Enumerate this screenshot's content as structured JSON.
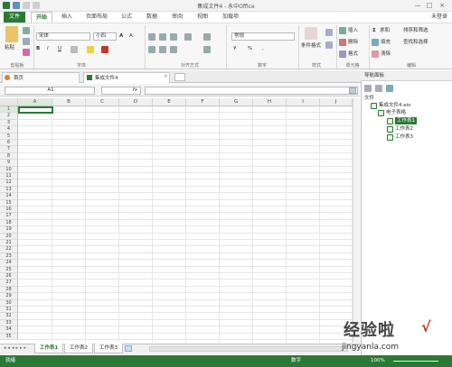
{
  "window": {
    "title": "集成文件4 - 永中Office",
    "user": "未登录",
    "minimize": "—",
    "maximize": "□",
    "close": "×"
  },
  "ribbon_tabs": [
    "文件",
    "开始",
    "插入",
    "页面布局",
    "公式",
    "数据",
    "审阅",
    "视图",
    "加载项"
  ],
  "ribbon": {
    "paste": "粘贴",
    "font_name": "宋体",
    "font_size": "小四",
    "number_format": "常规",
    "bold": "B",
    "italic": "I",
    "underline": "U",
    "conditional_format": "条件格式",
    "insert": "插入",
    "delete": "删除",
    "format": "格式",
    "sum": "求和",
    "fill": "填充",
    "clear": "清除",
    "sort_filter": "排序和筛选",
    "find_select": "查找和选择",
    "groups": [
      "剪贴板",
      "字体",
      "对齐方式",
      "数字",
      "样式",
      "单元格",
      "编辑"
    ],
    "percent": "%",
    "currency": "¥",
    "comma": ","
  },
  "doc_tabs": [
    "首页",
    "集成文件4"
  ],
  "formula_bar": {
    "cell_ref": "A1",
    "fx": "fx",
    "value": ""
  },
  "grid": {
    "columns": [
      "A",
      "B",
      "C",
      "D",
      "E",
      "F",
      "G",
      "H",
      "I",
      "J"
    ],
    "rows": [
      "1",
      "2",
      "3",
      "4",
      "5",
      "6",
      "7",
      "8",
      "9",
      "10",
      "11",
      "12",
      "13",
      "14",
      "15",
      "16",
      "17",
      "18",
      "19",
      "20",
      "21",
      "22",
      "23",
      "24",
      "25",
      "26",
      "27",
      "28",
      "29",
      "30",
      "31",
      "32",
      "33",
      "34",
      "35"
    ]
  },
  "sheet_tabs": [
    "工作表1",
    "工作表2",
    "工作表3"
  ],
  "status": {
    "ready": "就绪",
    "mode": "数字",
    "zoom": "100%"
  },
  "nav_panel": {
    "title": "导航面板",
    "root": "文件",
    "file": "集成文件4.eio",
    "folder": "电子表格",
    "sheets": [
      "工作表1",
      "工作表2",
      "工作表3"
    ]
  },
  "watermark": {
    "text": "经验啦",
    "url": "jingyanla.com"
  },
  "colors": {
    "accent": "#2a7a35"
  }
}
